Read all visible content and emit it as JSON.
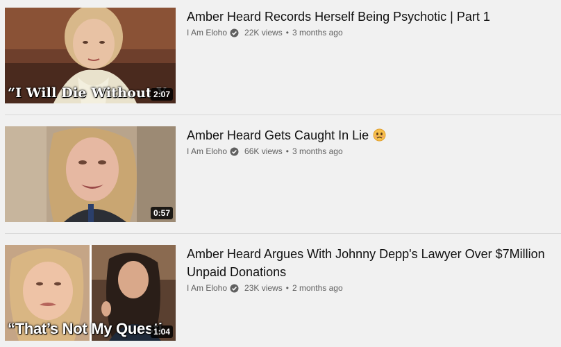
{
  "videos": [
    {
      "title": "Amber Heard Records Herself Being Psychotic | Part 1",
      "channel": "I Am Eloho",
      "views": "22K views",
      "age": "3 months ago",
      "duration": "2:07",
      "thumb_caption": "“I Will Die Without Y"
    },
    {
      "title": "Amber Heard Gets Caught In Lie",
      "emoji_icon": "worried-face-emoji",
      "channel": "I Am Eloho",
      "views": "66K views",
      "age": "3 months ago",
      "duration": "0:57"
    },
    {
      "title": "Amber Heard Argues With Johnny Depp's Lawyer Over $7Million Unpaid Donations",
      "channel": "I Am Eloho",
      "views": "23K views",
      "age": "2 months ago",
      "duration": "1:04",
      "thumb_caption": "“That’s Not My Questi"
    }
  ],
  "separator": "•",
  "icons": {
    "verified": "verified-check-icon"
  },
  "colors": {
    "background": "#f1f1f1",
    "title": "#0f0f0f",
    "meta": "#606060"
  }
}
